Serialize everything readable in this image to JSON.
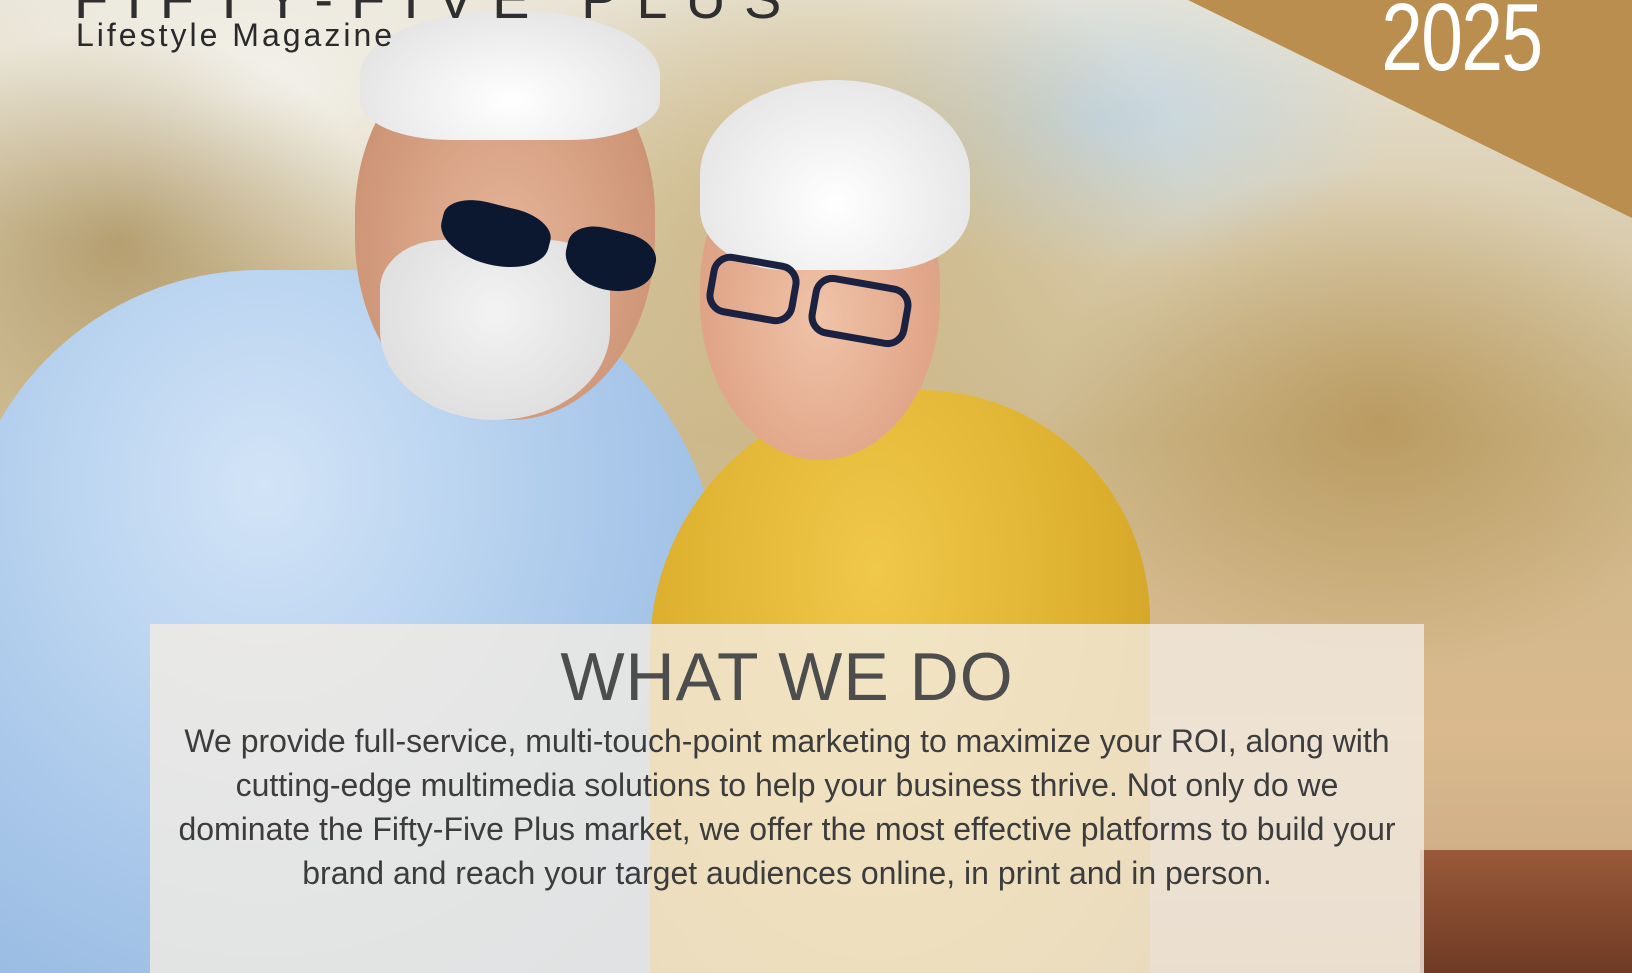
{
  "header": {
    "brand_title": "FIFTY-FIVE PLUS",
    "brand_subtitle": "Lifestyle Magazine",
    "year": "2025"
  },
  "panel": {
    "heading": "WHAT WE DO",
    "body": "We provide full-service, multi-touch-point marketing to maximize your ROI, along with cutting-edge multimedia solutions to help your business thrive. Not only do we dominate the Fifty-Five Plus market, we offer the most effective platforms to build your brand and reach your target audiences online, in print and in person."
  },
  "colors": {
    "accent_gold": "#b98e4e",
    "panel_bg": "#f2ece4",
    "heading_text": "#4d4d4d"
  }
}
